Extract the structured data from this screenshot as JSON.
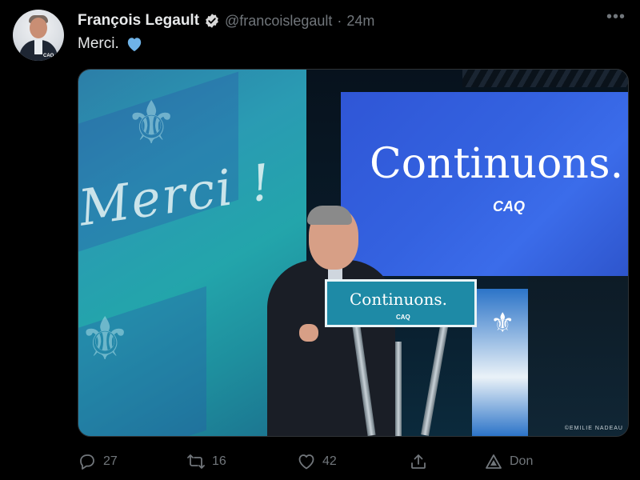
{
  "tweet": {
    "author_name": "François Legault",
    "handle": "@francoislegault",
    "separator": "·",
    "time": "24m",
    "text": "Merci.",
    "more_label": "•••"
  },
  "avatar": {
    "badge_text": "CAQ"
  },
  "media": {
    "background_script": "Merci !",
    "screen_title": "Continuons.",
    "screen_logo": "CAQ",
    "podium_title": "Continuons.",
    "podium_logo": "CAQ",
    "photo_credit": "©EMILIE NADEAU"
  },
  "actions": {
    "reply_count": "27",
    "retweet_count": "16",
    "like_count": "42",
    "share_label": "",
    "promote_label": "Don"
  },
  "icons": [
    "verified-icon",
    "blue-heart-icon",
    "reply-icon",
    "retweet-icon",
    "like-icon",
    "share-icon",
    "promote-icon",
    "more-icon"
  ],
  "colors": {
    "background": "#000000",
    "text": "#e7e9ea",
    "muted": "#71767b",
    "heart": "#6fb3e8"
  }
}
